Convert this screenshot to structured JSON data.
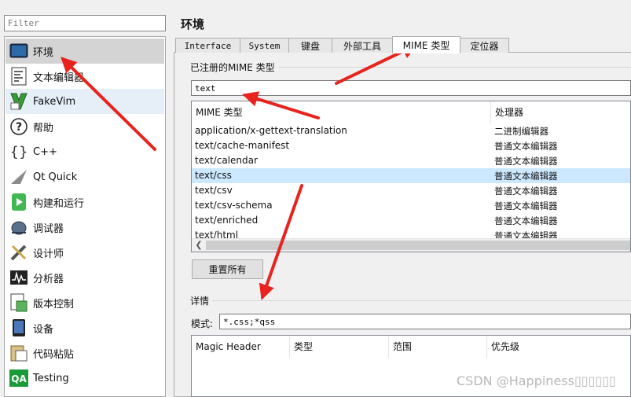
{
  "filter": {
    "placeholder": "Filter"
  },
  "sidebar": {
    "items": [
      {
        "label": "环境",
        "icon": "environment-icon"
      },
      {
        "label": "文本编辑器",
        "icon": "text-editor-icon"
      },
      {
        "label": "FakeVim",
        "icon": "fakevim-icon"
      },
      {
        "label": "帮助",
        "icon": "help-icon"
      },
      {
        "label": "C++",
        "icon": "cpp-icon"
      },
      {
        "label": "Qt Quick",
        "icon": "qt-quick-icon"
      },
      {
        "label": "构建和运行",
        "icon": "build-run-icon"
      },
      {
        "label": "调试器",
        "icon": "debugger-icon"
      },
      {
        "label": "设计师",
        "icon": "designer-icon"
      },
      {
        "label": "分析器",
        "icon": "analyzer-icon"
      },
      {
        "label": "版本控制",
        "icon": "version-control-icon"
      },
      {
        "label": "设备",
        "icon": "devices-icon"
      },
      {
        "label": "代码粘贴",
        "icon": "code-paste-icon"
      },
      {
        "label": "Testing",
        "icon": "testing-icon"
      }
    ]
  },
  "page_title": "环境",
  "tabs": [
    {
      "label": "Interface"
    },
    {
      "label": "System"
    },
    {
      "label": "键盘"
    },
    {
      "label": "外部工具"
    },
    {
      "label": "MIME 类型"
    },
    {
      "label": "定位器"
    }
  ],
  "registered_group": {
    "title": "已注册的MIME 类型",
    "filter_value": "text",
    "columns": [
      "MIME 类型",
      "处理器"
    ],
    "rows": [
      {
        "type": "application/x-gettext-translation",
        "handler": "二进制编辑器"
      },
      {
        "type": "text/cache-manifest",
        "handler": "普通文本编辑器"
      },
      {
        "type": "text/calendar",
        "handler": "普通文本编辑器"
      },
      {
        "type": "text/css",
        "handler": "普通文本编辑器"
      },
      {
        "type": "text/csv",
        "handler": "普通文本编辑器"
      },
      {
        "type": "text/csv-schema",
        "handler": "普通文本编辑器"
      },
      {
        "type": "text/enriched",
        "handler": "普通文本编辑器"
      },
      {
        "type": "text/html",
        "handler": "普通文本编辑器"
      }
    ],
    "reset_label": "重置所有"
  },
  "details_group": {
    "title": "详情",
    "pattern_label": "模式:",
    "pattern_value": "*.css;*qss",
    "columns": [
      "Magic Header",
      "类型",
      "范围",
      "优先级"
    ]
  },
  "watermark": "CSDN @Happiness▯▯▯▯▯▯",
  "colors": {
    "selection": "#cce8ff",
    "sidebar_selected": "#d4d4d4",
    "arrow": "#e8231e"
  }
}
